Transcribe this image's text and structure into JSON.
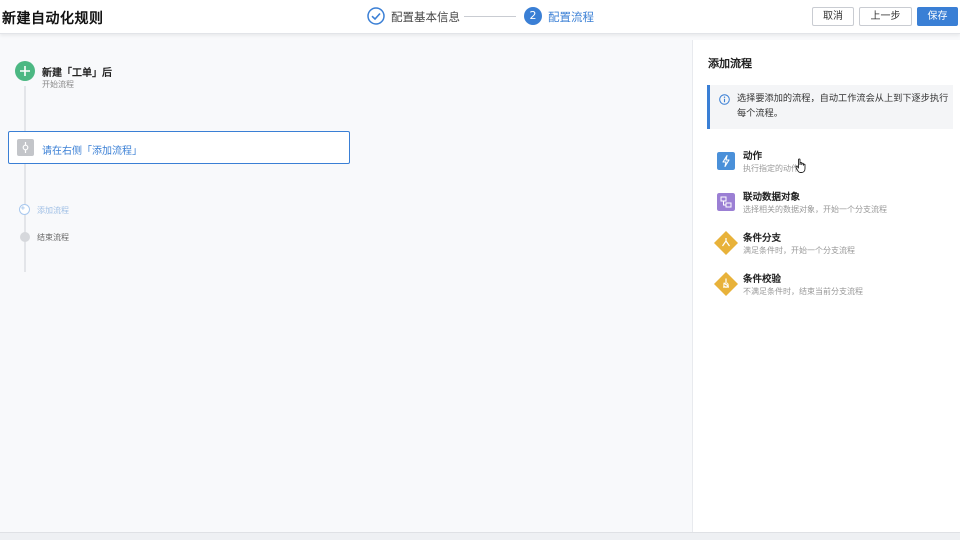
{
  "header": {
    "title": "新建自动化规则",
    "steps": [
      {
        "label": "配置基本信息",
        "state": "done"
      },
      {
        "number": "2",
        "label": "配置流程",
        "state": "active"
      }
    ],
    "buttons": {
      "cancel": "取消",
      "prev": "上一步",
      "save": "保存"
    }
  },
  "canvas": {
    "start": {
      "title": "新建「工单」后",
      "subtitle": "开始流程"
    },
    "placeholder": {
      "text": "请在右侧「添加流程」"
    },
    "add": {
      "label": "添加流程"
    },
    "end": {
      "label": "结束流程"
    }
  },
  "panel": {
    "title": "添加流程",
    "info": "选择要添加的流程，自动工作流会从上到下逐步执行每个流程。",
    "options": [
      {
        "title": "动作",
        "desc": "执行指定的动作",
        "icon": "lightning-icon",
        "color": "#4a90d9"
      },
      {
        "title": "联动数据对象",
        "desc": "选择相关的数据对象，开始一个分支流程",
        "icon": "linked-data-icon",
        "color": "#9b7fd4"
      },
      {
        "title": "条件分支",
        "desc": "满足条件时，开始一个分支流程",
        "icon": "branch-icon",
        "color": "#e8b23a"
      },
      {
        "title": "条件校验",
        "desc": "不满足条件时，结束当前分支流程",
        "icon": "check-condition-icon",
        "color": "#e8b23a"
      }
    ]
  },
  "colors": {
    "accent": "#3a7fd5",
    "start_node": "#4cb883"
  }
}
